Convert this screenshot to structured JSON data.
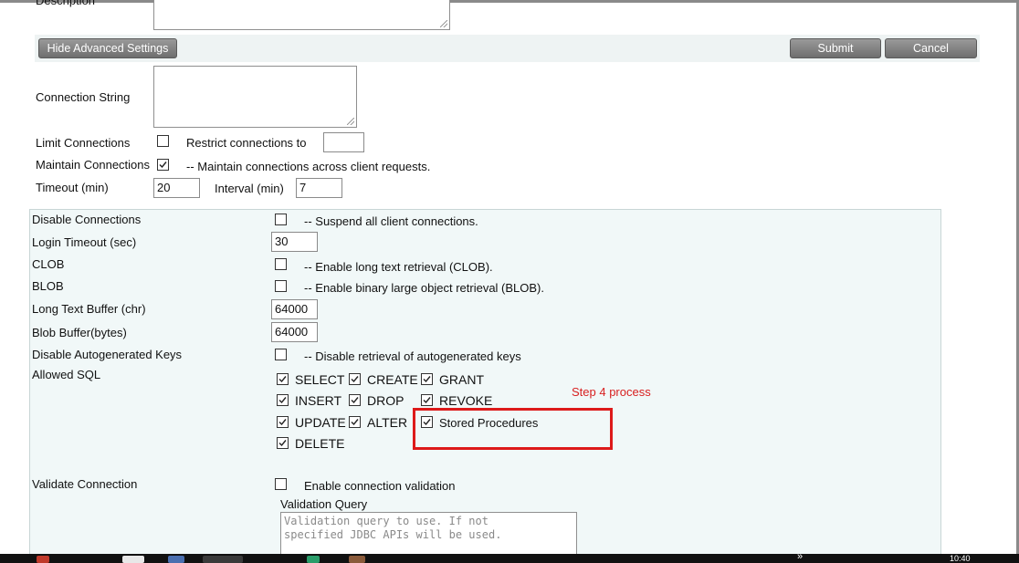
{
  "top": {
    "description_label": "Description",
    "hide_advanced_label": "Hide Advanced Settings",
    "submit_label": "Submit",
    "cancel_label": "Cancel"
  },
  "connection": {
    "connection_string_label": "Connection String",
    "limit_connections_label": "Limit Connections",
    "restrict_label": "Restrict connections to",
    "restrict_value": "",
    "maintain_connections_label": "Maintain Connections",
    "maintain_hint": "-- Maintain connections across client requests.",
    "timeout_label": "Timeout (min)",
    "timeout_value": "20",
    "interval_label": "Interval (min)",
    "interval_value": "7"
  },
  "advanced": {
    "disable_connections_label": "Disable Connections",
    "disable_connections_hint": "-- Suspend all client connections.",
    "login_timeout_label": "Login Timeout (sec)",
    "login_timeout_value": "30",
    "clob_label": "CLOB",
    "clob_hint": "-- Enable long text retrieval (CLOB).",
    "blob_label": "BLOB",
    "blob_hint": "-- Enable binary large object retrieval (BLOB).",
    "long_text_label": "Long Text Buffer (chr)",
    "long_text_value": "64000",
    "blob_buffer_label": "Blob Buffer(bytes)",
    "blob_buffer_value": "64000",
    "autokeys_label": "Disable Autogenerated Keys",
    "autokeys_hint": "-- Disable retrieval of autogenerated keys",
    "allowed_sql_label": "Allowed SQL",
    "sql": {
      "select": "SELECT",
      "create": "CREATE",
      "grant": "GRANT",
      "insert": "INSERT",
      "drop": "DROP",
      "revoke": "REVOKE",
      "update": "UPDATE",
      "alter": "ALTER",
      "stored_procedures": "Stored Procedures",
      "delete": "DELETE"
    },
    "annotation": "Step 4 process",
    "validate_label": "Validate Connection",
    "validate_hint": "Enable connection validation",
    "validation_query_label": "Validation Query",
    "validation_query_placeholder": "Validation query to use. If not\nspecified JDBC APIs will be used."
  },
  "taskbar": {
    "overflow_glyph": "»",
    "clock": "10:40"
  }
}
